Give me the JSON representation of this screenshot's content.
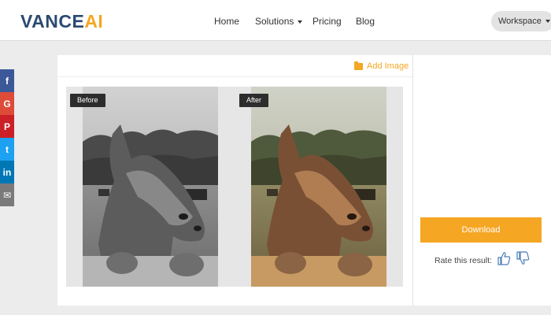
{
  "header": {
    "logo_main": "VANCE",
    "logo_accent": "AI",
    "nav": [
      "Home",
      "Solutions",
      "Pricing",
      "Blog"
    ],
    "workspace_label": "Workspace"
  },
  "share_icons": [
    "facebook-icon",
    "google-icon",
    "pinterest-icon",
    "twitter-icon",
    "linkedin-icon",
    "mail-icon"
  ],
  "share_glyphs": {
    "facebook": "f",
    "google": "G",
    "pinterest": "P",
    "twitter": "t",
    "linkedin": "in",
    "mail": "✉"
  },
  "editor": {
    "add_image_label": "Add Image",
    "before_label": "Before",
    "after_label": "After"
  },
  "sidebar": {
    "download_label": "Download",
    "rate_label": "Rate this result:"
  },
  "colors": {
    "accent": "#f5a623",
    "brand": "#2b4a72",
    "tag_bg": "#2d2d2d",
    "facebook": "#3b5998",
    "google": "#dd4b39",
    "pinterest": "#cb2027",
    "twitter": "#1da1f2",
    "linkedin": "#0077b5",
    "mail": "#7a7a7a"
  }
}
